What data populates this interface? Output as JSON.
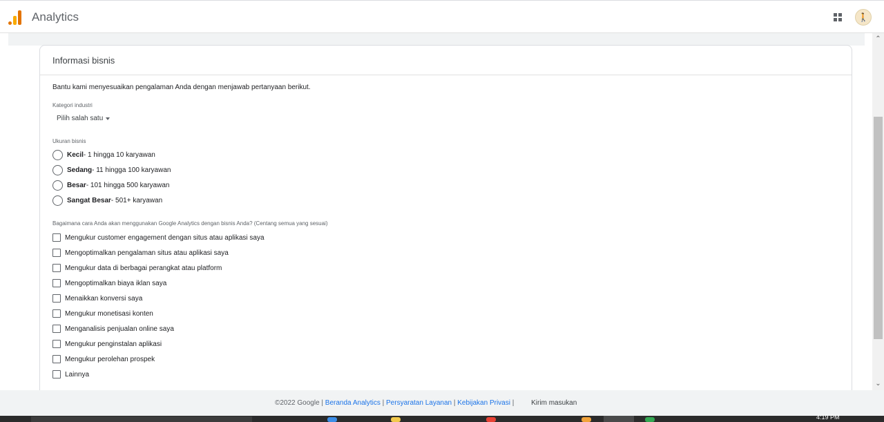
{
  "header": {
    "app_title": "Analytics",
    "apps_icon": "apps-grid-icon",
    "avatar_icon": "user-avatar-icon",
    "avatar_glyph": "🚶"
  },
  "card": {
    "title": "Informasi bisnis",
    "intro": "Bantu kami menyesuaikan pengalaman Anda dengan menjawab pertanyaan berikut.",
    "industry": {
      "label": "Kategori industri",
      "selected": "Pilih salah satu"
    },
    "size": {
      "label": "Ukuran bisnis",
      "options": [
        {
          "bold": "Kecil",
          "rest": " - 1 hingga 10 karyawan"
        },
        {
          "bold": "Sedang",
          "rest": " - 11 hingga 100 karyawan"
        },
        {
          "bold": "Besar",
          "rest": " - 101 hingga 500 karyawan"
        },
        {
          "bold": "Sangat Besar",
          "rest": " - 501+ karyawan"
        }
      ]
    },
    "usage": {
      "label": "Bagaimana cara Anda akan menggunakan Google Analytics dengan bisnis Anda? (Centang semua yang sesuai)",
      "options": [
        "Mengukur customer engagement dengan situs atau aplikasi saya",
        "Mengoptimalkan pengalaman situs atau aplikasi saya",
        "Mengukur data di berbagai perangkat atau platform",
        "Mengoptimalkan biaya iklan saya",
        "Menaikkan konversi saya",
        "Mengukur monetisasi konten",
        "Menganalisis penjualan online saya",
        "Mengukur penginstalan aplikasi",
        "Mengukur perolehan prospek",
        "Lainnya"
      ]
    }
  },
  "footer": {
    "copyright": "©2022 Google",
    "links": [
      "Beranda Analytics",
      "Persyaratan Layanan",
      "Kebijakan Privasi"
    ],
    "separator": " | ",
    "feedback": "Kirim masukan"
  },
  "taskbar": {
    "time": "4:19 PM"
  },
  "colors": {
    "link": "#1a73e8",
    "logo_orange": "#e37400",
    "logo_yellow": "#f9ab00"
  }
}
